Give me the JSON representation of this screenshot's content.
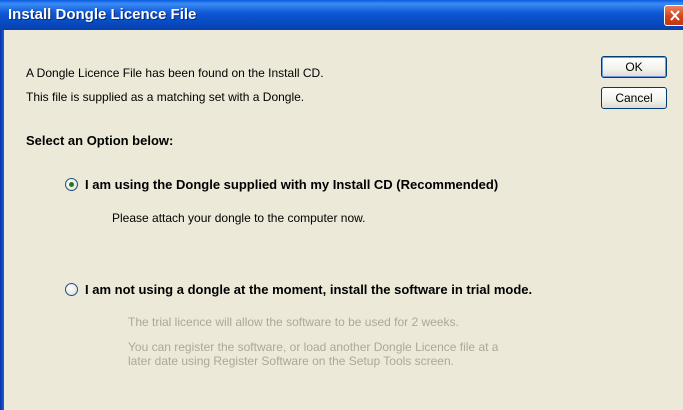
{
  "window": {
    "title": "Install Dongle Licence File"
  },
  "message": {
    "line1": "A Dongle Licence File has been found on the Install CD.",
    "line2": "This file is supplied as a matching set with a Dongle."
  },
  "buttons": {
    "ok_label": "OK",
    "cancel_label": "Cancel"
  },
  "options_heading": "Select an Option below:",
  "options": [
    {
      "label": "I am using the Dongle supplied with my Install CD (Recommended)",
      "selected": true,
      "description": "Please attach your dongle to the computer now."
    },
    {
      "label": "I am not using a dongle at the moment, install the software in trial mode.",
      "selected": false,
      "description_lines": [
        "The trial licence will allow the software to be used for 2 weeks.",
        "You can register the software, or load another Dongle Licence file at a",
        "later date using Register Software on the Setup Tools screen."
      ]
    }
  ],
  "colors": {
    "titlebar": "#0d55d4",
    "dialog_bg": "#ece9d8",
    "disabled_text": "#aca899"
  }
}
